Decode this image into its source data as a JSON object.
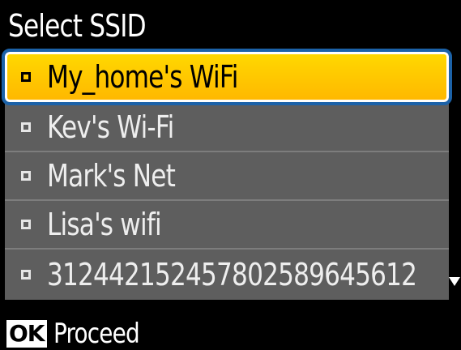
{
  "screen_title": "Select SSID",
  "ssid_list": {
    "items": [
      {
        "label": "My_home's WiFi",
        "selected": true
      },
      {
        "label": "Kev's Wi-Fi",
        "selected": false
      },
      {
        "label": "Mark's Net",
        "selected": false
      },
      {
        "label": "Lisa's wifi",
        "selected": false
      },
      {
        "label": "312442152457802589645612",
        "selected": false
      }
    ],
    "more_indicator_icon": "down-triangle-icon"
  },
  "footer": {
    "ok_key": "OK",
    "action_label": "Proceed"
  },
  "colors": {
    "background": "#000000",
    "list_background": "#5e5e5e",
    "selected_fill": "#ffcc00",
    "selected_outline": "#1c62a8",
    "text": "#ffffff"
  }
}
